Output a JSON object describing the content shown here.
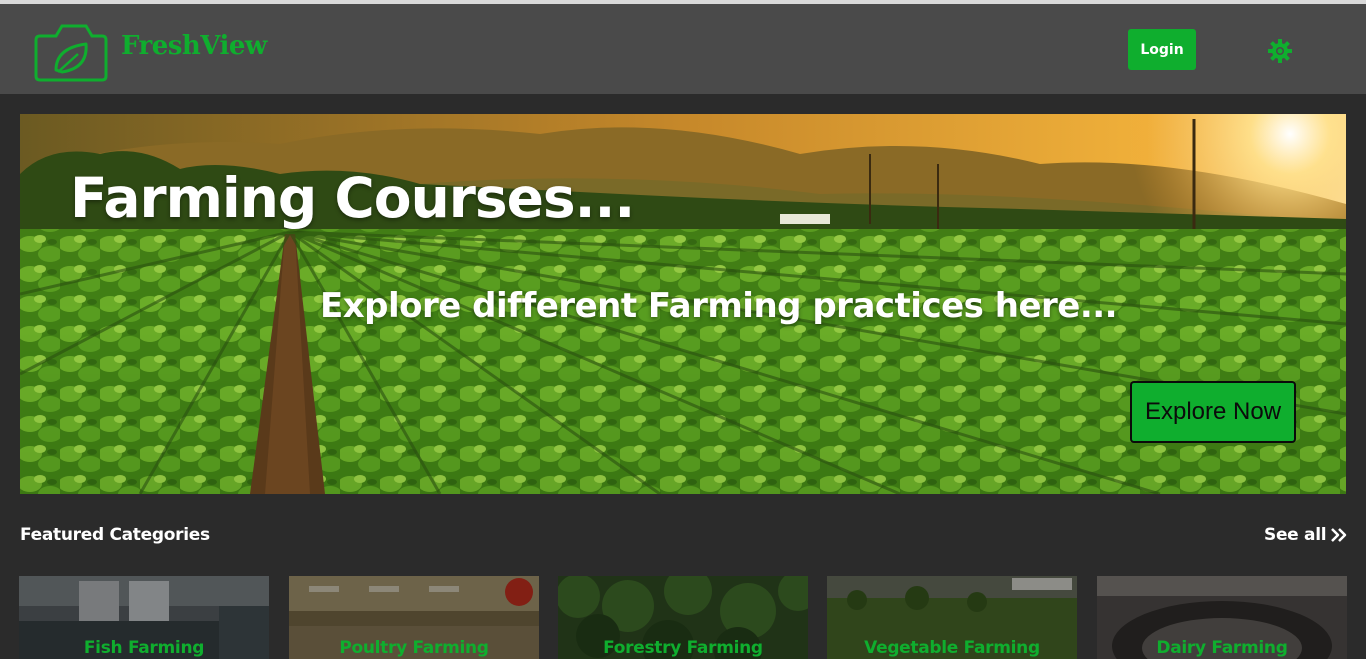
{
  "navbar": {
    "brand": "FreshView",
    "login_label": "Login",
    "logo_icon": "camera-leaf-icon",
    "settings_icon": "gear-icon"
  },
  "hero": {
    "title": "Farming Courses...",
    "subtitle": "Explore different Farming practices here...",
    "cta_label": "Explore Now"
  },
  "featured": {
    "title": "Featured Categories",
    "see_all_label": "See all",
    "see_all_icon": "double-chevron-right-icon",
    "categories": [
      {
        "label": "Fish Farming"
      },
      {
        "label": "Poultry Farming"
      },
      {
        "label": "Forestry Farming"
      },
      {
        "label": "Vegetable Farming"
      },
      {
        "label": "Dairy Farming"
      }
    ]
  },
  "colors": {
    "accent": "#0fae2e",
    "navbar_bg": "#4a4a4a",
    "page_bg": "#2b2b2b"
  }
}
